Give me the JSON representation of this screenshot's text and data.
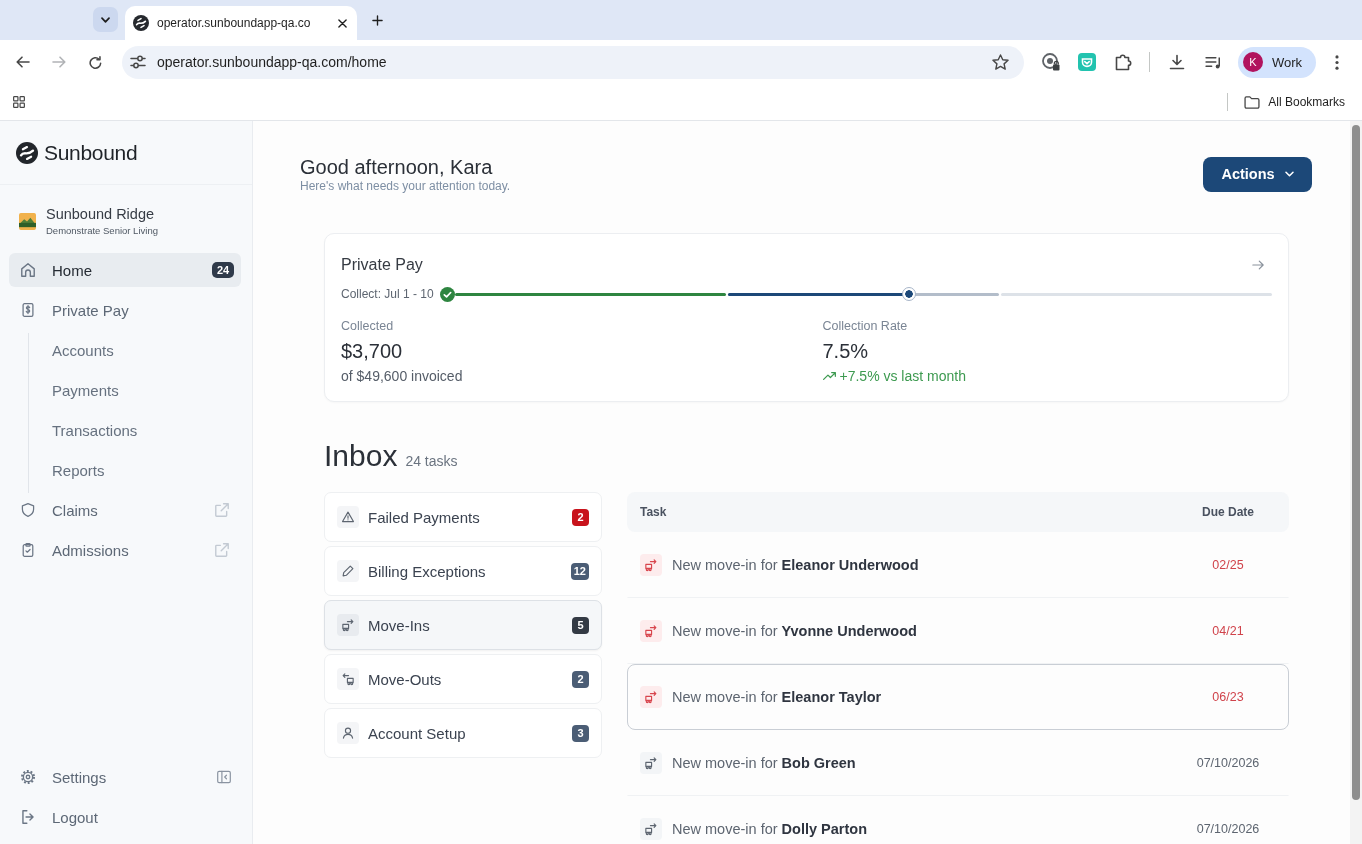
{
  "browser": {
    "tab": {
      "title": "operator.sunboundapp-qa.co"
    },
    "address_bar": {
      "value": "operator.sunboundapp-qa.com/home"
    },
    "profile": {
      "initial": "K",
      "label": "Work"
    },
    "bookmarks_bar": {
      "folder": "All Bookmarks"
    }
  },
  "sidebar": {
    "brand": "Sunbound",
    "facility": {
      "name": "Sunbound Ridge",
      "subtitle": "Demonstrate Senior Living"
    },
    "nav": [
      {
        "label": "Home",
        "selected": true,
        "external": false,
        "badge": "24"
      },
      {
        "label": "Private Pay",
        "selected": false,
        "external": false,
        "children": [
          {
            "label": "Accounts",
            "selected": false
          },
          {
            "label": "Payments",
            "selected": false
          },
          {
            "label": "Transactions",
            "selected": false
          },
          {
            "label": "Reports",
            "selected": false
          }
        ]
      },
      {
        "label": "Claims",
        "selected": false,
        "external": true
      },
      {
        "label": "Admissions",
        "selected": false,
        "external": true
      }
    ],
    "footer": [
      {
        "label": "Settings"
      },
      {
        "label": "Logout"
      }
    ]
  },
  "header": {
    "greeting": "Good afternoon, Kara",
    "subtitle": "Here's what needs your attention today.",
    "action_button": "Actions"
  },
  "private_pay_card": {
    "title": "Private Pay",
    "period": "Collect: Jul 1 - 10",
    "phases": [
      {
        "kind": "complete"
      },
      {
        "kind": "current",
        "level": 0.67
      },
      {
        "kind": "upcoming"
      }
    ],
    "stats": [
      {
        "kind": "plain",
        "label": "Collected",
        "value": "$3,700",
        "note": "of $49,600 invoiced"
      },
      {
        "kind": "trend_up",
        "label": "Collection Rate",
        "value": "7.5%",
        "note": "+7.5% vs last month"
      }
    ]
  },
  "inbox": {
    "title": "Inbox",
    "count": "24 tasks",
    "categories": [
      {
        "label": "Failed Payments",
        "count": "2",
        "color": "#c8131c",
        "selected": false
      },
      {
        "label": "Billing Exceptions",
        "count": "12",
        "color": "#4b5d75",
        "selected": false
      },
      {
        "label": "Move-Ins",
        "count": "5",
        "color": "#333a44",
        "selected": true
      },
      {
        "label": "Move-Outs",
        "count": "2",
        "color": "#4b5d75",
        "selected": false
      },
      {
        "label": "Account Setup",
        "count": "3",
        "color": "#4b5d75",
        "selected": false
      }
    ],
    "table": {
      "columns": [
        "Task",
        "Due Date"
      ],
      "rows": [
        {
          "task": "New move-in for **Eleanor Underwood**",
          "due": "02/25",
          "overdue": true,
          "highlighted": false
        },
        {
          "task": "New move-in for **Yvonne Underwood**",
          "due": "04/21",
          "overdue": true,
          "highlighted": false
        },
        {
          "task": "New move-in for **Eleanor Taylor**",
          "due": "06/23",
          "overdue": true,
          "highlighted": true
        },
        {
          "task": "New move-in for **Bob Green**",
          "due": "07/10/2026",
          "overdue": false,
          "highlighted": false
        },
        {
          "task": "New move-in for **Dolly Parton**",
          "due": "07/10/2026",
          "overdue": false,
          "highlighted": false
        }
      ]
    }
  }
}
